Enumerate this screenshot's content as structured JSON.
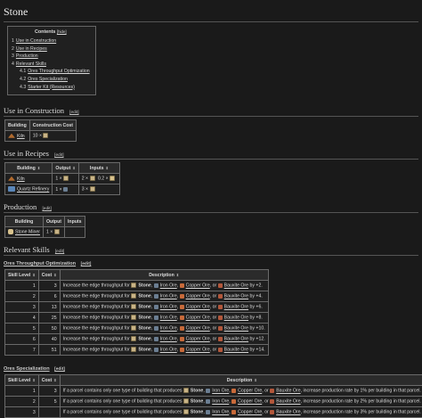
{
  "page_title": "Stone",
  "toc": {
    "title": "Contents",
    "hide_label": "[hide]",
    "items": [
      {
        "num": "1",
        "label": "Use in Construction"
      },
      {
        "num": "2",
        "label": "Use in Recipes"
      },
      {
        "num": "3",
        "label": "Production"
      },
      {
        "num": "4",
        "label": "Relevant Skills"
      },
      {
        "num": "4.1",
        "label": "Ores Throughput Optimization"
      },
      {
        "num": "4.2",
        "label": "Ores Specialization"
      },
      {
        "num": "4.3",
        "label": "Starter Kit (Resources)"
      }
    ]
  },
  "edit_label": "[edit]",
  "construction": {
    "heading": "Use in Construction",
    "headers": [
      "Building",
      "Construction Cost"
    ],
    "rows": [
      {
        "building": "Kiln",
        "cost": "10 ×"
      }
    ]
  },
  "recipes": {
    "heading": "Use in Recipes",
    "headers": [
      "Building",
      "Output",
      "Inputs"
    ],
    "rows": [
      {
        "building": "Kiln",
        "output": "1 ×",
        "input_a": "2 ×",
        "input_b": "0.2 ×"
      },
      {
        "building": "Quartz Refinery",
        "output": "1 ×",
        "input_a": "3 ×",
        "input_b": ""
      }
    ]
  },
  "production": {
    "heading": "Production",
    "headers": [
      "Building",
      "Output",
      "Inputs"
    ],
    "rows": [
      {
        "building": "Stone Miner",
        "output": "1 ×",
        "inputs": ""
      }
    ]
  },
  "skills": {
    "heading": "Relevant Skills",
    "throughput": {
      "heading": "Ores Throughput Optimization",
      "headers": [
        "Skill Level",
        "Cost",
        "Description"
      ],
      "desc_prefix": "Increase the edge throughput for",
      "ores": [
        "Stone",
        "Iron Ore",
        "Copper Ore",
        "Bauxite Ore"
      ],
      "rows": [
        {
          "level": "1",
          "cost": "3",
          "amount": "2"
        },
        {
          "level": "2",
          "cost": "6",
          "amount": "4"
        },
        {
          "level": "3",
          "cost": "13",
          "amount": "6"
        },
        {
          "level": "4",
          "cost": "25",
          "amount": "8"
        },
        {
          "level": "5",
          "cost": "50",
          "amount": "10"
        },
        {
          "level": "6",
          "cost": "40",
          "amount": "12"
        },
        {
          "level": "7",
          "cost": "51",
          "amount": "14"
        }
      ]
    },
    "specialization": {
      "heading": "Ores Specialization",
      "headers": [
        "Skill Level",
        "Cost",
        "Description"
      ],
      "desc_prefix": "If a parcel contains only one type of building that produces",
      "rows": [
        {
          "level": "1",
          "cost": "3",
          "pct": "1"
        },
        {
          "level": "2",
          "cost": "5",
          "pct": "2"
        },
        {
          "level": "3",
          "cost": "",
          "pct": "3"
        }
      ]
    }
  }
}
